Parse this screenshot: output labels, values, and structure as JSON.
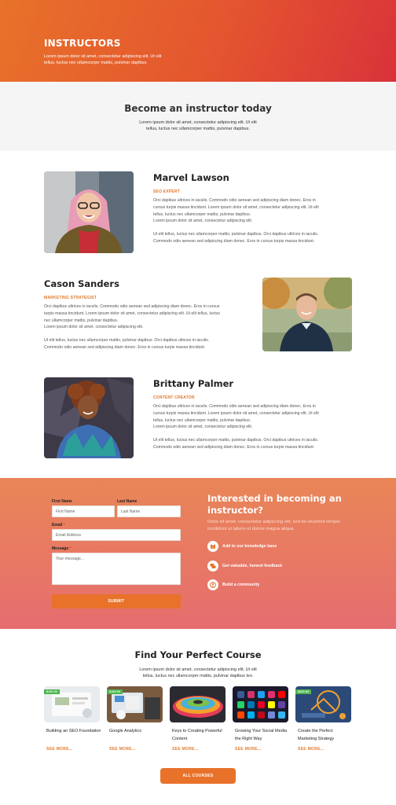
{
  "hero": {
    "title": "INSTRUCTORS",
    "text": "Lorem ipsum dolor sit amet, consectetur adipiscing elit. Ut elit tellus, luctus nec ullamcorper mattis, pulvinar dapibus."
  },
  "become": {
    "title": "Become an instructor today",
    "text": "Lorem ipsum dolor sit amet, consectetur adipiscing elit. Ut elit tellus, luctus nec ullamcorper mattis, pulvinar dapibus."
  },
  "instructors": [
    {
      "name": "Marvel Lawson",
      "role": "SEO EXPERT",
      "bio1": "Orci dapibus ultrices in iaculis. Commodo odio aenean sed adipiscing diam donec. Eros in cursus turpis massa tincidunt. Lorem ipsum dolor sit amet, consectetur adipiscing elit. Ut elit tellus, luctus nec ullamcorper mattis, pulvinar dapibus.",
      "bio1b": "Lorem ipsum dolor sit amet, consectetur adipiscing elit.",
      "bio2": "Ut elit tellus, luctus nec ullamcorper mattis, pulvinar dapibus. Orci dapibus ultrices in iaculis. Commodo odio aenean sed adipiscing diam donec. Eros in cursus turpis massa tincidunt."
    },
    {
      "name": "Cason Sanders",
      "role": "MARKETING STRATEGIST",
      "bio1": "Orci dapibus ultrices in iaculis. Commodo odio aenean sed adipiscing diam donec. Eros in cursus turpis massa tincidunt. Lorem ipsum dolor sit amet, consectetur adipiscing elit. Ut elit tellus, luctus nec ullamcorper mattis, pulvinar dapibus.",
      "bio1b": "Lorem ipsum dolor sit amet, consectetur adipiscing elit.",
      "bio2": "Ut elit tellus, luctus nec ullamcorper mattis, pulvinar dapibus. Orci dapibus ultrices in iaculis. Commodo odio aenean sed adipiscing diam donec. Eros in cursus turpis massa tincidunt."
    },
    {
      "name": "Brittany Palmer",
      "role": "CONTENT CREATOR",
      "bio1": "Orci dapibus ultrices in iaculis. Commodo odio aenean sed adipiscing diam donec. Eros in cursus turpis massa tincidunt. Lorem ipsum dolor sit amet, consectetur adipiscing elit. Ut elit tellus, luctus nec ullamcorper mattis, pulvinar dapibus.",
      "bio1b": "Lorem ipsum dolor sit amet, consectetur adipiscing elit.",
      "bio2": "Ut elit tellus, luctus nec ullamcorper mattis, pulvinar dapibus. Orci dapibus ultrices in iaculis. Commodo odio aenean sed adipiscing diam donec. Eros in cursus turpis massa tincidunt."
    }
  ],
  "form": {
    "first_label": "First Name",
    "first_placeholder": "First Name",
    "last_label": "Last Name",
    "last_placeholder": "Last Name",
    "email_label": "Email",
    "email_placeholder": "Email Address",
    "message_label": "Message",
    "message_placeholder": "Your message...",
    "required_mark": "*",
    "submit": "SUBMIT"
  },
  "interest": {
    "title": "Interested in becoming an instructor?",
    "text": "Dolor sit amet, consectetur adipiscing elit, sed do eiusmod tempor incididunt ut labore et dolore magna aliqua.",
    "benefits": [
      {
        "icon": "book-icon",
        "label": "Add to our knowledge base"
      },
      {
        "icon": "chat-bubbles-icon",
        "label": "Get valuable, honest feedback"
      },
      {
        "icon": "community-icon",
        "label": "Build a community"
      }
    ]
  },
  "courses": {
    "title": "Find Your Perfect Course",
    "text": "Lorem ipsum dolor sit amet, consectetur adipiscing elit. Ut elit tellus, luctus nec ullamcorper mattis, pulvinar dapibus leo.",
    "items": [
      {
        "badge": "$150.00",
        "title": "Building an SEO Foundation",
        "link": "SEE MORE..."
      },
      {
        "badge": "$150.00",
        "title": "Google Analytics",
        "link": "SEE MORE..."
      },
      {
        "badge": "",
        "title": "Keys to Creating Powerful Content",
        "link": "SEE MORE..."
      },
      {
        "badge": "",
        "title": "Growing Your Social Media the Right Way",
        "link": "SEE MORE..."
      },
      {
        "badge": "$200.00",
        "title": "Create the Perfect Marketing Strategy",
        "link": "SEE MORE..."
      }
    ],
    "all_button": "ALL COURSES"
  },
  "colors": {
    "accent": "#e8722a",
    "hero_end": "#d9323a",
    "badge": "#4bb54f"
  }
}
